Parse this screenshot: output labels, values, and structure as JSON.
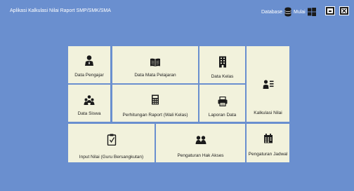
{
  "app": {
    "title": "Aplikasi Kalkulasi Nilai Raport SMP/SMK/SMA",
    "database_label": "Database",
    "start_label": "Mulai"
  },
  "tiles": {
    "data_pengajar": "Data Pengajar",
    "data_mata_pelajaran": "Data Mata Pelajaran",
    "data_kelas": "Data Kelas",
    "kalkulasi_nilai": "Kalkulasi Nilai",
    "data_siswa": "Data Siswa",
    "perhitungan_raport": "Perhitungan Raport (Wali Kelas)",
    "laporan_data": "Laporan Data",
    "input_nilai": "Input Nilai (Guru Bersangkutan)",
    "pengaturan_hak_akses": "Pengaturan Hak Akses",
    "pengaturan_jadwal": "Pengaturan Jadwal"
  },
  "icons": {
    "database": "database-icon",
    "start": "windows-icon",
    "minimize": "minimize-icon",
    "close": "close-icon",
    "data_pengajar": "teacher-icon",
    "data_mata_pelajaran": "book-icon",
    "data_kelas": "building-icon",
    "kalkulasi_nilai": "user-list-icon",
    "data_siswa": "students-icon",
    "perhitungan_raport": "calculator-icon",
    "laporan_data": "printer-icon",
    "input_nilai": "clipboard-icon",
    "pengaturan_hak_akses": "users-access-icon",
    "pengaturan_jadwal": "calendar-icon"
  },
  "colors": {
    "background": "#6a8fcf",
    "tile": "#f2f2dc",
    "icon": "#1a1a1a"
  }
}
